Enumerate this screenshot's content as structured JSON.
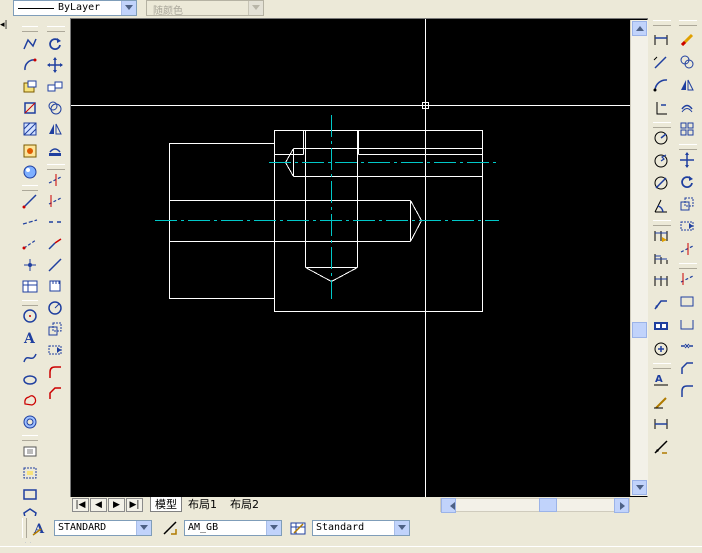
{
  "top_bar": {
    "linetype_value": "ByLayer",
    "color_value": "随颜色"
  },
  "drawing_tabs": [
    "模型",
    "布局1",
    "布局2"
  ],
  "tab_nav_glyphs": [
    "|◀",
    "◀",
    "▶",
    "▶|"
  ],
  "style_bar": {
    "text_style": "STANDARD",
    "dim_style": "AM_GB",
    "table_style": "Standard"
  },
  "colors": {
    "canvas": "#000000",
    "geometry": "#ffffff",
    "centerline": "#00c8c8",
    "chrome": "#ece9d8",
    "scroll_accent": "#c1d3fb"
  },
  "left_toolbar_a_icons": [
    "draw-polyline-icon",
    "draw-arc-icon",
    "insert-block-icon",
    "make-block-icon",
    "hatch-icon",
    "gradient-icon",
    "region-icon",
    "line-icon",
    "construction-line-icon",
    "ray-icon",
    "point-icon",
    "table-icon",
    "circle-icon",
    "text-icon",
    "multiline-text-icon",
    "spline-icon",
    "ellipse-icon",
    "revision-cloud-icon",
    "donut-icon",
    "wipeout-icon",
    "boundary-icon",
    "rectangle-icon",
    "polygon-icon"
  ],
  "left_toolbar_b_icons": [
    "rotate-icon",
    "move-icon",
    "copy-icon",
    "offset-icon",
    "mirror-icon",
    "array-icon",
    "trim-icon",
    "extend-icon",
    "break-icon",
    "join-icon",
    "line-icon",
    "measure-icon",
    "circle-icon",
    "scale-icon",
    "stretch-icon",
    "fillet-icon",
    "chamfer-icon"
  ],
  "right_toolbar_a_icons": [
    "linear-dimension-icon",
    "aligned-dimension-icon",
    "arc-length-icon",
    "ordinate-icon",
    "radius-icon",
    "jogged-icon",
    "diameter-icon",
    "angular-icon",
    "quick-dimension-icon",
    "baseline-icon",
    "continue-icon",
    "quick-leader-icon",
    "tolerance-icon",
    "center-mark-icon",
    "dim-edit-icon",
    "dim-text-edit-icon",
    "dim-update-icon",
    "dim-style-icon"
  ],
  "right_toolbar_b_icons": [
    "erase-icon",
    "copy-icon",
    "mirror-icon",
    "offset-icon",
    "array-icon",
    "move-icon",
    "rotate-icon",
    "scale-icon",
    "stretch-icon",
    "trim-icon",
    "extend-icon",
    "break-icon",
    "join-icon",
    "chamfer-icon",
    "fillet-icon",
    "explode-icon"
  ]
}
